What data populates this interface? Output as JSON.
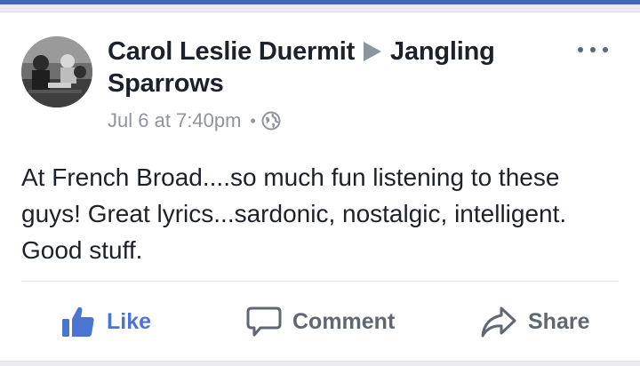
{
  "post": {
    "author": "Carol Leslie Duermit",
    "target": "Jangling Sparrows",
    "timestamp": "Jul 6 at 7:40pm",
    "separator": "•",
    "privacy_icon": "globe-icon",
    "text": "At French Broad....so much fun listening to these guys! Great lyrics...sardonic, nostalgic, intelligent. Good stuff."
  },
  "actions": {
    "like_label": "Like",
    "comment_label": "Comment",
    "share_label": "Share"
  },
  "colors": {
    "like_active": "#4a76d1",
    "text": "#1d2129",
    "meta": "#90949c",
    "brand_bar": "#4267b2"
  }
}
